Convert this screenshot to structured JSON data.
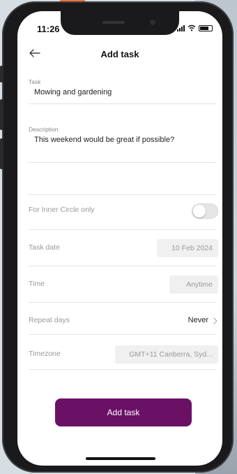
{
  "status_bar": {
    "time": "11:26"
  },
  "header": {
    "title": "Add task"
  },
  "task": {
    "label": "Task",
    "value": "Mowing and gardening"
  },
  "description": {
    "label": "Description",
    "value": "This weekend would be great if possible?"
  },
  "inner_circle": {
    "label": "For Inner Circle only",
    "enabled": false
  },
  "task_date": {
    "label": "Task date",
    "value": "10 Feb 2024"
  },
  "time": {
    "label": "Time",
    "value": "Anytime"
  },
  "repeat_days": {
    "label": "Repeat days",
    "value": "Never"
  },
  "timezone": {
    "label": "Timezone",
    "value": "GMT+11 Canberra, Syd..."
  },
  "submit": {
    "label": "Add task"
  },
  "colors": {
    "primary": "#6a1166",
    "background": "#ffffff",
    "muted_text": "#999999"
  },
  "icons": {
    "back": "arrow-left-icon",
    "chevron": "chevron-right-icon",
    "signal": "signal-icon",
    "wifi": "wifi-icon",
    "battery": "battery-icon"
  }
}
